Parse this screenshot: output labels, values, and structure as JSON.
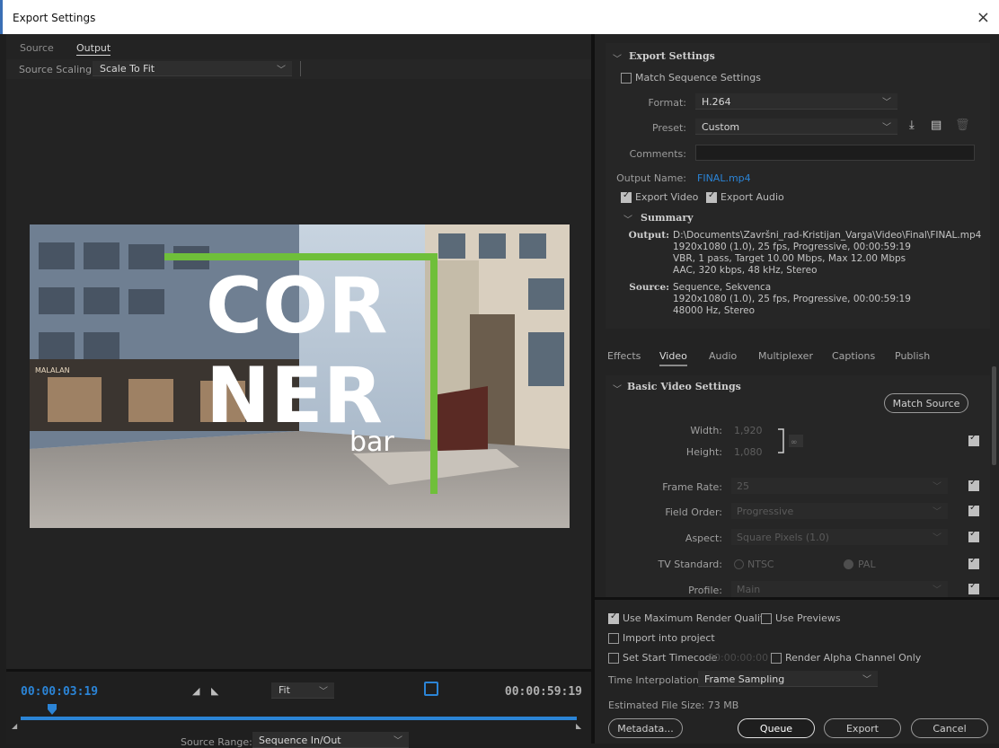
{
  "window": {
    "title": "Export Settings",
    "close": "×"
  },
  "left": {
    "tabs": [
      "Source",
      "Output"
    ],
    "scaling_label": "Source Scaling:",
    "scaling_value": "Scale To Fit",
    "preview_text": {
      "line1": "COR",
      "line2": "NER",
      "line3": "bar",
      "sign1": "MALALAN"
    },
    "timecode_in": "00:00:03:19",
    "timecode_out": "00:00:59:19",
    "zoom_value": "Fit",
    "source_range_label": "Source Range:",
    "source_range_value": "Sequence In/Out",
    "playhead_fraction": 0.056
  },
  "export_settings": {
    "header": "Export Settings",
    "match_sequence": "Match Sequence Settings",
    "format_label": "Format:",
    "format_value": "H.264",
    "preset_label": "Preset:",
    "preset_value": "Custom",
    "comments_label": "Comments:",
    "comments_value": "",
    "output_name_label": "Output Name:",
    "output_name_value": "FINAL.mp4",
    "export_video": "Export Video",
    "export_audio": "Export Audio",
    "summary_header": "Summary",
    "summary_output_key": "Output:",
    "summary_output_lines": [
      "D:\\Documents\\Završni_rad-Kristijan_Varga\\Video\\Final\\FINAL.mp4",
      "1920x1080 (1.0), 25 fps, Progressive, 00:00:59:19",
      "VBR, 1 pass, Target 10.00 Mbps, Max 12.00 Mbps",
      "AAC, 320 kbps, 48 kHz, Stereo"
    ],
    "summary_source_key": "Source:",
    "summary_source_lines": [
      "Sequence, Sekvenca",
      "1920x1080 (1.0), 25 fps, Progressive, 00:00:59:19",
      "48000 Hz, Stereo"
    ]
  },
  "tabs": [
    "Effects",
    "Video",
    "Audio",
    "Multiplexer",
    "Captions",
    "Publish"
  ],
  "video": {
    "header": "Basic Video Settings",
    "match_source": "Match Source",
    "width_label": "Width:",
    "width_value": "1,920",
    "height_label": "Height:",
    "height_value": "1,080",
    "frame_rate_label": "Frame Rate:",
    "frame_rate_value": "25",
    "field_order_label": "Field Order:",
    "field_order_value": "Progressive",
    "aspect_label": "Aspect:",
    "aspect_value": "Square Pixels (1.0)",
    "tv_standard_label": "TV Standard:",
    "tv_ntsc": "NTSC",
    "tv_pal": "PAL",
    "profile_label": "Profile:",
    "profile_value": "Main"
  },
  "bottom": {
    "max_render": "Use Maximum Render Quality",
    "use_previews": "Use Previews",
    "import_project": "Import into project",
    "start_timecode": "Set Start Timecode",
    "start_timecode_value": "00:00:00:00",
    "render_alpha": "Render Alpha Channel Only",
    "time_interp_label": "Time Interpolation:",
    "time_interp_value": "Frame Sampling",
    "file_size": "Estimated File Size:  73 MB",
    "metadata": "Metadata...",
    "queue": "Queue",
    "export": "Export",
    "cancel": "Cancel"
  },
  "colors": {
    "accent": "#2b84d6",
    "logo_green": "#6fbf3a"
  }
}
